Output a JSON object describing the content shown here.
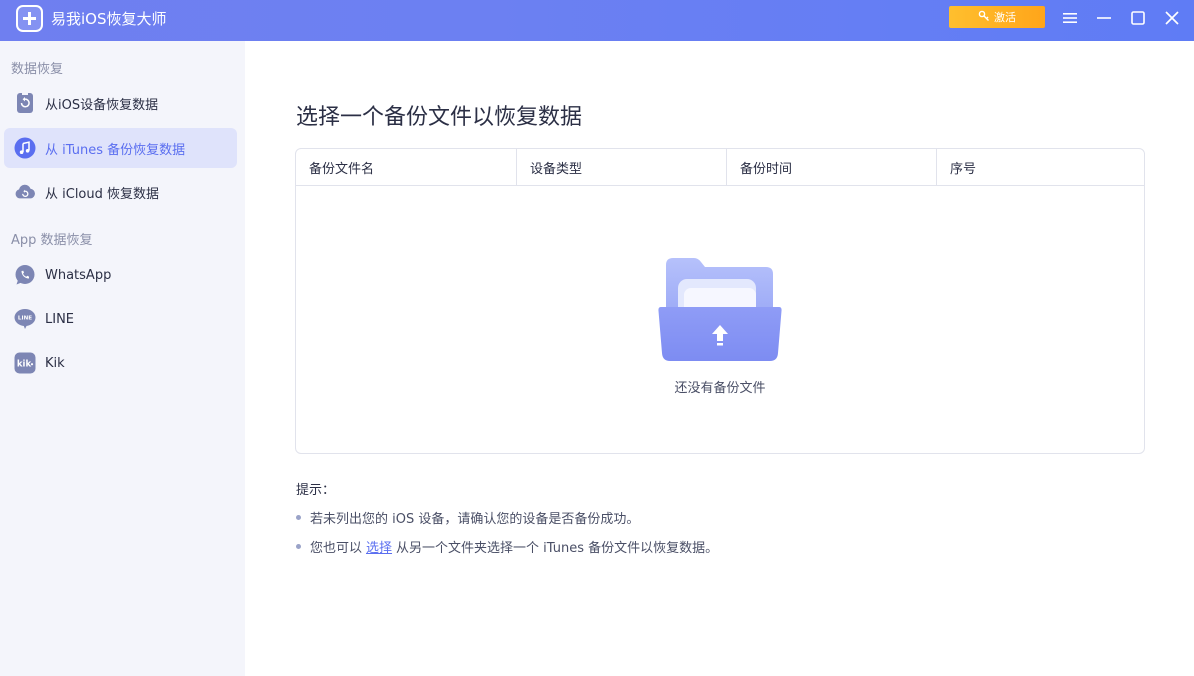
{
  "app": {
    "title": "易我iOS恢复大师",
    "activate_label": "激活"
  },
  "sidebar": {
    "section1": "数据恢复",
    "section2": "App 数据恢复",
    "items": [
      {
        "label": "从iOS设备恢复数据",
        "icon": "device-restore-icon",
        "active": false
      },
      {
        "label": "从 iTunes 备份恢复数据",
        "icon": "itunes-music-icon",
        "active": true
      },
      {
        "label": "从 iCloud 恢复数据",
        "icon": "icloud-icon",
        "active": false
      },
      {
        "label": "WhatsApp",
        "icon": "whatsapp-icon",
        "active": false
      },
      {
        "label": "LINE",
        "icon": "line-icon",
        "active": false
      },
      {
        "label": "Kik",
        "icon": "kik-icon",
        "active": false
      }
    ]
  },
  "main": {
    "title": "选择一个备份文件以恢复数据",
    "columns": [
      "备份文件名",
      "设备类型",
      "备份时间",
      "序号"
    ],
    "empty_text": "还没有备份文件",
    "tips": {
      "title": "提示：",
      "tip1": "若未列出您的 iOS 设备，请确认您的设备是否备份成功。",
      "tip2_prefix": "您也可以",
      "tip2_link": "选择",
      "tip2_suffix": "从另一个文件夹选择一个 iTunes 备份文件以恢复数据。"
    }
  },
  "colors": {
    "accent": "#5a6ef0",
    "titlebar": "#6c80f2",
    "activate": "#ffa51a"
  }
}
